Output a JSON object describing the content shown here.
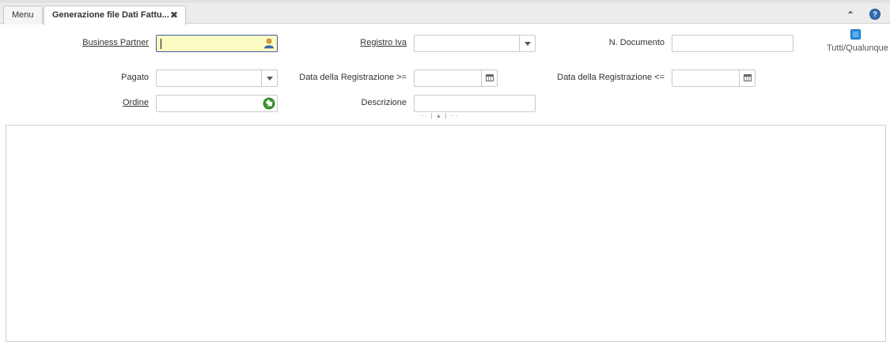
{
  "tabs": {
    "menu_label": "Menu",
    "active_label": "Generazione file Dati Fattu...",
    "close_glyph": "✖"
  },
  "toolbar": {
    "collapse_glyph": "⌃",
    "help_glyph": "?"
  },
  "form": {
    "business_partner": {
      "label": "Business Partner",
      "value": ""
    },
    "registro_iva": {
      "label": "Registro Iva",
      "value": ""
    },
    "n_documento": {
      "label": "N. Documento",
      "value": ""
    },
    "pagato": {
      "label": "Pagato",
      "value": ""
    },
    "data_reg_from": {
      "label": "Data della Registrazione >=",
      "value": ""
    },
    "data_reg_to": {
      "label": "Data della Registrazione <=",
      "value": ""
    },
    "ordine": {
      "label": "Ordine",
      "value": ""
    },
    "descrizione": {
      "label": "Descrizione",
      "value": ""
    },
    "tutti_qualunque": {
      "label": "Tutti/Qualunque"
    }
  },
  "icons": {
    "bp": "user-icon",
    "order": "lookup-arrow-icon",
    "calendar": "calendar-icon",
    "dropdown": "chevron-down-icon"
  },
  "colors": {
    "focused_bg": "#fdfbc4",
    "focused_border": "#3a5fa5",
    "toggle": "#2e8fe0",
    "lookup_green": "#3a9a2e"
  },
  "splitter": {
    "text": "··· | ▲ | ···"
  }
}
